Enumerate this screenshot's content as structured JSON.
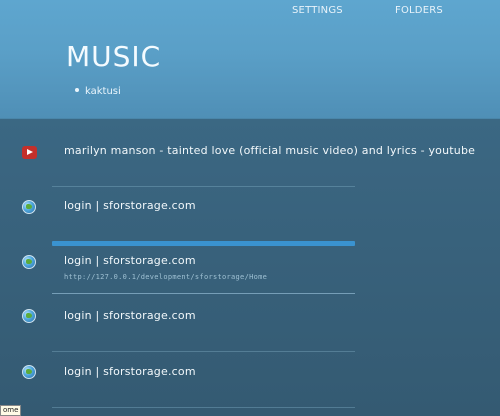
{
  "nav": {
    "settings": "SETTINGS",
    "folders": "FOLDERS"
  },
  "page": {
    "title": "MUSIC",
    "subitems": [
      "kaktusi"
    ]
  },
  "items": [
    {
      "title": "marilyn manson - tainted love (official music video) and lyrics - youtube",
      "icon": "youtube-icon",
      "url": ""
    },
    {
      "title": "login | sforstorage.com",
      "icon": "globe-icon",
      "url": ""
    },
    {
      "title": "login | sforstorage.com",
      "icon": "globe-icon",
      "url": "http://127.0.0.1/development/sforstorage/Home"
    },
    {
      "title": "login | sforstorage.com",
      "icon": "globe-icon",
      "url": ""
    },
    {
      "title": "login | sforstorage.com",
      "icon": "globe-icon",
      "url": ""
    }
  ],
  "tooltip": "ome",
  "colors": {
    "header": "#5ea6cf",
    "body": "#3a6580",
    "accent": "#3a93d0",
    "youtube": "#c4302b"
  }
}
